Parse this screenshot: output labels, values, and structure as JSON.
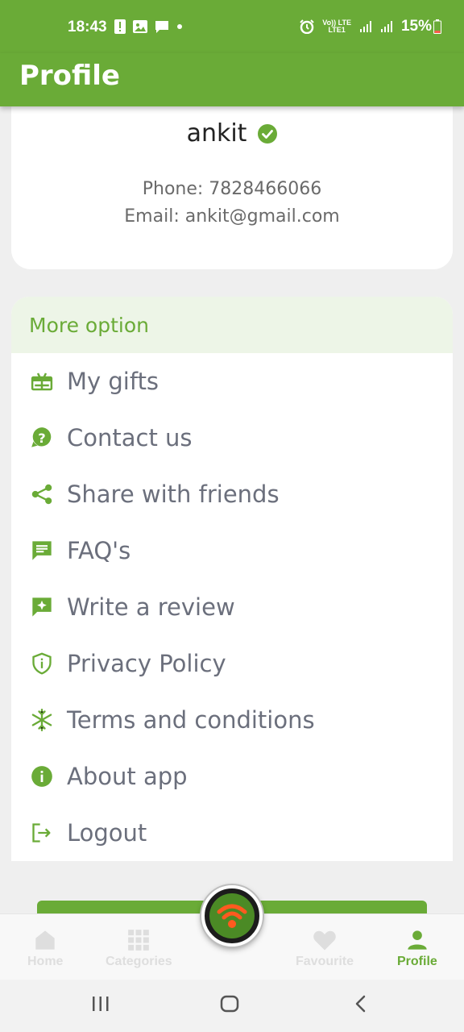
{
  "status_bar": {
    "time": "18:43",
    "battery": "15%",
    "network_top": "Vo)) LTE",
    "network_bottom": "LTE1"
  },
  "app_bar": {
    "title": "Profile"
  },
  "profile": {
    "name": "ankit",
    "phone": "Phone: 7828466066",
    "email": "Email: ankit@gmail.com",
    "verified_icon": "check-circle-icon"
  },
  "more_options": {
    "title": "More option",
    "items": [
      {
        "label": "My gifts",
        "icon": "gift-icon"
      },
      {
        "label": "Contact us",
        "icon": "help-circle-icon"
      },
      {
        "label": "Share with friends",
        "icon": "share-icon"
      },
      {
        "label": "FAQ's",
        "icon": "chat-icon"
      },
      {
        "label": "Write a review",
        "icon": "review-icon"
      },
      {
        "label": "Privacy Policy",
        "icon": "shield-icon"
      },
      {
        "label": "Terms and conditions",
        "icon": "snowflake-icon"
      },
      {
        "label": "About app",
        "icon": "info-icon"
      },
      {
        "label": "Logout",
        "icon": "logout-icon"
      }
    ]
  },
  "bottom_nav": {
    "items": [
      {
        "label": "Home",
        "icon": "home-icon"
      },
      {
        "label": "Categories",
        "icon": "grid-icon"
      },
      {
        "label": "Favourite",
        "icon": "heart-icon"
      },
      {
        "label": "Profile",
        "icon": "person-icon",
        "active": true
      }
    ],
    "center_icon": "wifi-icon"
  },
  "colors": {
    "primary": "#6aab37",
    "option_text": "#6b6f7c",
    "header_tint": "#edf5e7"
  }
}
